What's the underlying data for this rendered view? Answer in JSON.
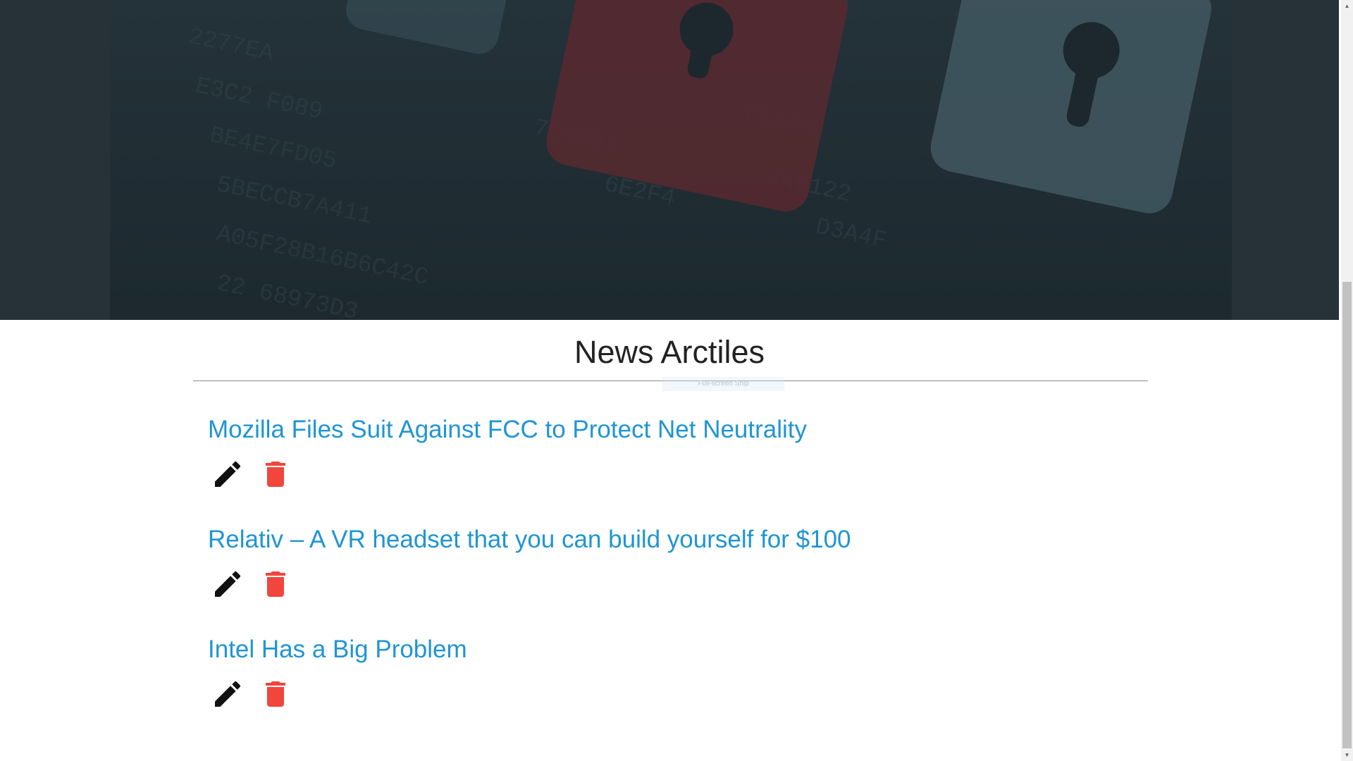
{
  "page": {
    "section_title": "News Arctiles",
    "snip_tag": "Full-screen Snip"
  },
  "articles": [
    {
      "title": "Mozilla Files Suit Against FCC to Protect Net Neutrality"
    },
    {
      "title": "Relativ – A VR headset that you can build yourself for $100"
    },
    {
      "title": "Intel Has a Big Problem"
    }
  ],
  "icons": {
    "edit": "pencil-icon",
    "delete": "trash-icon"
  },
  "colors": {
    "link": "#1f95d3",
    "delete": "#f0463c",
    "edit": "#111111",
    "hero_bg": "#263238"
  }
}
